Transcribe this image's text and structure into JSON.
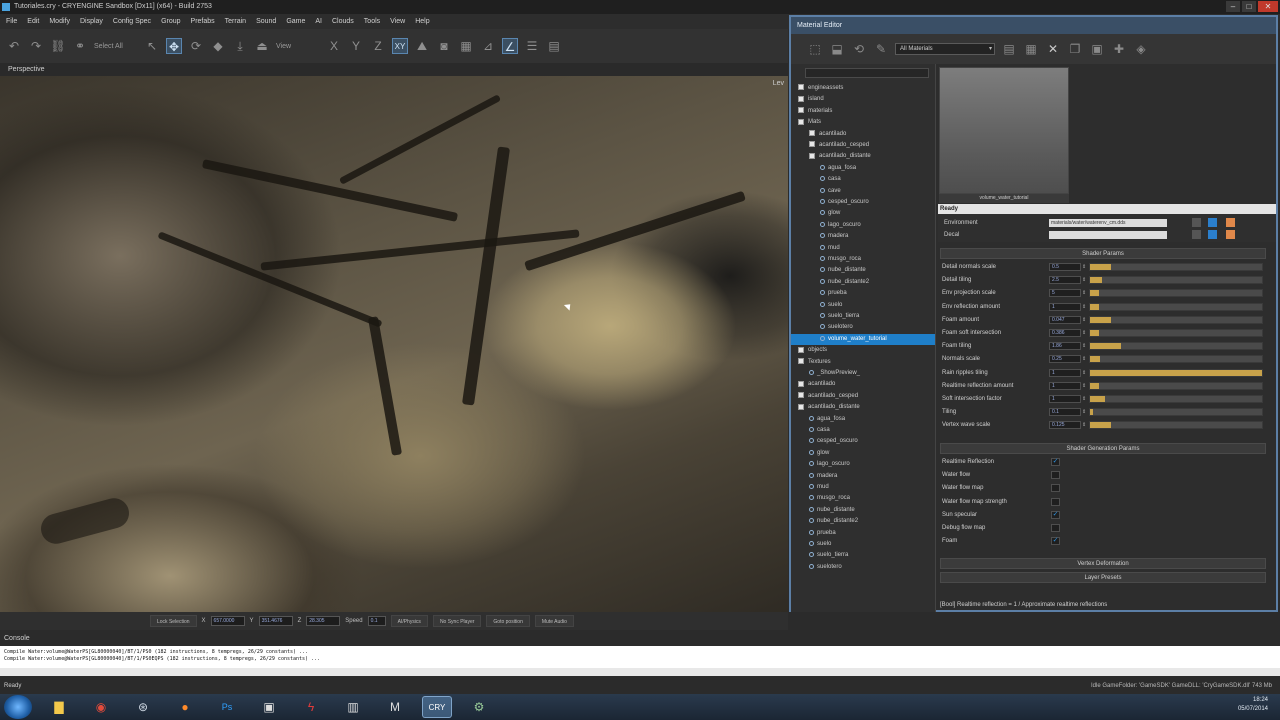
{
  "window": {
    "title": "Tutoriales.cry - CRYENGINE Sandbox [Dx11] (x64) - Build 2753",
    "controls": [
      "–",
      "□",
      "✕"
    ]
  },
  "menu": [
    "File",
    "Edit",
    "Modify",
    "Display",
    "Config Spec",
    "Group",
    "Prefabs",
    "Terrain",
    "Sound",
    "Game",
    "AI",
    "Clouds",
    "Tools",
    "View",
    "Help"
  ],
  "toolbar": {
    "select_all_label": "Select All",
    "view_label": "View",
    "axes": [
      "X",
      "Y",
      "Z",
      "XY"
    ]
  },
  "viewport": {
    "label": "Perspective",
    "tag": "Lev"
  },
  "status_controls": {
    "lock_selection": "Lock Selection",
    "x": "657.0000",
    "y": "351.4676",
    "z": "28.305",
    "speed_label": "Speed",
    "speed_value": "0.1",
    "buttons": [
      "AI/Physics",
      "No Sync Player",
      "Goto position",
      "Mute Audio"
    ]
  },
  "console": {
    "title": "Console",
    "lines": [
      "Compile Water:volume@WaterPS[GL80000040]/BT/1/PS0 (182 instructions, 8 tempregs, 26/29 constants) ...",
      "Compile Water:volume@WaterPS[GL80000040]/BT/1/PS0EQPS (182 instructions, 8 tempregs, 26/29 constants) ..."
    ]
  },
  "statusbar": {
    "left": "Ready",
    "right": "Idle   GameFolder: 'GameSDK'   GameDLL: 'CryGameSDK.dll'   743 Mb"
  },
  "taskbar": {
    "apps": [
      "start",
      "explorer",
      "chrome",
      "steam",
      "firefox",
      "photoshop",
      "sandbox",
      "flash",
      "notepad",
      "maya",
      "cryengine",
      "cryedit"
    ],
    "time": "18:24",
    "date": "05/07/2014"
  },
  "material_editor": {
    "title": "Material Editor",
    "filter": "All Materials",
    "tree": [
      {
        "label": "engineassets",
        "indent": 0,
        "kind": "folder"
      },
      {
        "label": "island",
        "indent": 0,
        "kind": "folder"
      },
      {
        "label": "materials",
        "indent": 0,
        "kind": "folder"
      },
      {
        "label": "Mats",
        "indent": 0,
        "kind": "folder"
      },
      {
        "label": "acantilado",
        "indent": 1,
        "kind": "mat"
      },
      {
        "label": "acantilado_cesped",
        "indent": 1,
        "kind": "mat"
      },
      {
        "label": "acantilado_distante",
        "indent": 1,
        "kind": "mat"
      },
      {
        "label": "agua_fosa",
        "indent": 2,
        "kind": "sub"
      },
      {
        "label": "casa",
        "indent": 2,
        "kind": "sub"
      },
      {
        "label": "cave",
        "indent": 2,
        "kind": "sub"
      },
      {
        "label": "cesped_oscuro",
        "indent": 2,
        "kind": "sub"
      },
      {
        "label": "glow",
        "indent": 2,
        "kind": "sub"
      },
      {
        "label": "lago_oscuro",
        "indent": 2,
        "kind": "sub"
      },
      {
        "label": "madera",
        "indent": 2,
        "kind": "sub"
      },
      {
        "label": "mud",
        "indent": 2,
        "kind": "sub"
      },
      {
        "label": "musgo_roca",
        "indent": 2,
        "kind": "sub"
      },
      {
        "label": "nube_distante",
        "indent": 2,
        "kind": "sub"
      },
      {
        "label": "nube_distante2",
        "indent": 2,
        "kind": "sub"
      },
      {
        "label": "prueba",
        "indent": 2,
        "kind": "sub"
      },
      {
        "label": "suelo",
        "indent": 2,
        "kind": "sub"
      },
      {
        "label": "suelo_tierra",
        "indent": 2,
        "kind": "sub"
      },
      {
        "label": "suelotero",
        "indent": 2,
        "kind": "sub"
      },
      {
        "label": "volume_water_tutorial",
        "indent": 2,
        "kind": "sub",
        "selected": true
      },
      {
        "label": "objects",
        "indent": 0,
        "kind": "folder"
      },
      {
        "label": "Textures",
        "indent": 0,
        "kind": "folder"
      },
      {
        "label": "_ShowPreview_",
        "indent": 1,
        "kind": "sub"
      },
      {
        "label": "acantilado",
        "indent": 0,
        "kind": "mat"
      },
      {
        "label": "acantilado_cesped",
        "indent": 0,
        "kind": "mat"
      },
      {
        "label": "acantilado_distante",
        "indent": 0,
        "kind": "mat"
      },
      {
        "label": "agua_fosa",
        "indent": 1,
        "kind": "sub"
      },
      {
        "label": "casa",
        "indent": 1,
        "kind": "sub"
      },
      {
        "label": "cesped_oscuro",
        "indent": 1,
        "kind": "sub"
      },
      {
        "label": "glow",
        "indent": 1,
        "kind": "sub"
      },
      {
        "label": "lago_oscuro",
        "indent": 1,
        "kind": "sub"
      },
      {
        "label": "madera",
        "indent": 1,
        "kind": "sub"
      },
      {
        "label": "mud",
        "indent": 1,
        "kind": "sub"
      },
      {
        "label": "musgo_roca",
        "indent": 1,
        "kind": "sub"
      },
      {
        "label": "nube_distante",
        "indent": 1,
        "kind": "sub"
      },
      {
        "label": "nube_distante2",
        "indent": 1,
        "kind": "sub"
      },
      {
        "label": "prueba",
        "indent": 1,
        "kind": "sub"
      },
      {
        "label": "suelo",
        "indent": 1,
        "kind": "sub"
      },
      {
        "label": "suelo_tierra",
        "indent": 1,
        "kind": "sub"
      },
      {
        "label": "suelotero",
        "indent": 1,
        "kind": "sub"
      }
    ],
    "preview_label": "volume_water_tutorial",
    "ready": "Ready",
    "textures": [
      {
        "label": "Environment",
        "path": "materials/water/waterenv_cm.dds"
      },
      {
        "label": "Decal",
        "path": ""
      }
    ],
    "shader_params_title": "Shader Params",
    "shader_params": [
      {
        "label": "Detail normals scale",
        "value": "0.5",
        "fill": 0.12
      },
      {
        "label": "Detail tiling",
        "value": "2.5",
        "fill": 0.07
      },
      {
        "label": "Env projection scale",
        "value": "5",
        "fill": 0.05
      },
      {
        "label": "Env reflection amount",
        "value": "1",
        "fill": 0.05
      },
      {
        "label": "Foam amount",
        "value": "0.047",
        "fill": 0.12
      },
      {
        "label": "Foam soft intersection",
        "value": "0.386",
        "fill": 0.05
      },
      {
        "label": "Foam tiling",
        "value": "1.86",
        "fill": 0.18
      },
      {
        "label": "Normals scale",
        "value": "0.25",
        "fill": 0.06
      },
      {
        "label": "Rain ripples tiling",
        "value": "1",
        "fill": 1.0
      },
      {
        "label": "Realtime reflection amount",
        "value": "1",
        "fill": 0.05
      },
      {
        "label": "Soft intersection factor",
        "value": "1",
        "fill": 0.09
      },
      {
        "label": "Tiling",
        "value": "0.1",
        "fill": 0.02
      },
      {
        "label": "Vertex wave scale",
        "value": "0.125",
        "fill": 0.12
      }
    ],
    "shader_gen_title": "Shader Generation Params",
    "shader_gen_params": [
      {
        "label": "Realtime Reflection",
        "checked": true
      },
      {
        "label": "Water flow",
        "checked": false
      },
      {
        "label": "Water flow map",
        "checked": false
      },
      {
        "label": "Water flow map strength",
        "checked": false
      },
      {
        "label": "Sun specular",
        "checked": true
      },
      {
        "label": "Debug flow map",
        "checked": false
      },
      {
        "label": "Foam",
        "checked": true
      }
    ],
    "vertex_def_title": "Vertex Deformation",
    "layer_presets_title": "Layer Presets",
    "status": "[Bool] Realtime reflection = 1 / Approximate realtime reflections"
  },
  "colors": {
    "accent": "#5c7fa6",
    "selection": "#1f7fc9",
    "slider_fill": "#c8a24a"
  }
}
